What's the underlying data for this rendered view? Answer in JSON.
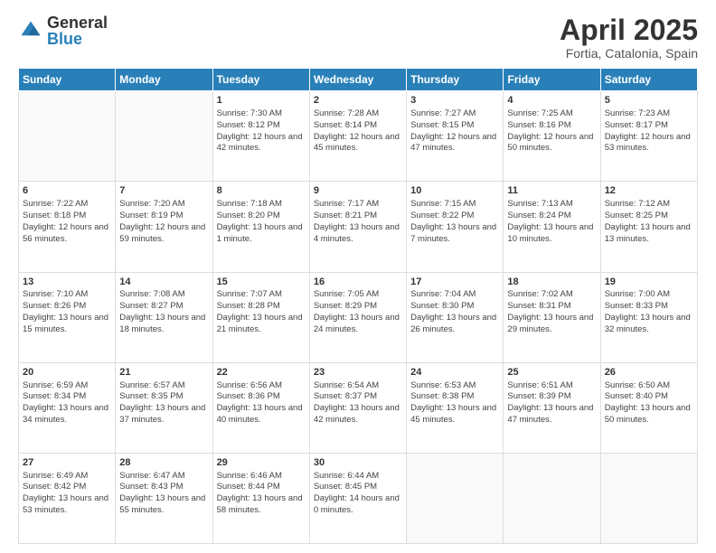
{
  "header": {
    "logo_general": "General",
    "logo_blue": "Blue",
    "title": "April 2025",
    "location": "Fortia, Catalonia, Spain"
  },
  "weekdays": [
    "Sunday",
    "Monday",
    "Tuesday",
    "Wednesday",
    "Thursday",
    "Friday",
    "Saturday"
  ],
  "weeks": [
    [
      {
        "day": "",
        "info": ""
      },
      {
        "day": "",
        "info": ""
      },
      {
        "day": "1",
        "info": "Sunrise: 7:30 AM\nSunset: 8:12 PM\nDaylight: 12 hours and 42 minutes."
      },
      {
        "day": "2",
        "info": "Sunrise: 7:28 AM\nSunset: 8:14 PM\nDaylight: 12 hours and 45 minutes."
      },
      {
        "day": "3",
        "info": "Sunrise: 7:27 AM\nSunset: 8:15 PM\nDaylight: 12 hours and 47 minutes."
      },
      {
        "day": "4",
        "info": "Sunrise: 7:25 AM\nSunset: 8:16 PM\nDaylight: 12 hours and 50 minutes."
      },
      {
        "day": "5",
        "info": "Sunrise: 7:23 AM\nSunset: 8:17 PM\nDaylight: 12 hours and 53 minutes."
      }
    ],
    [
      {
        "day": "6",
        "info": "Sunrise: 7:22 AM\nSunset: 8:18 PM\nDaylight: 12 hours and 56 minutes."
      },
      {
        "day": "7",
        "info": "Sunrise: 7:20 AM\nSunset: 8:19 PM\nDaylight: 12 hours and 59 minutes."
      },
      {
        "day": "8",
        "info": "Sunrise: 7:18 AM\nSunset: 8:20 PM\nDaylight: 13 hours and 1 minute."
      },
      {
        "day": "9",
        "info": "Sunrise: 7:17 AM\nSunset: 8:21 PM\nDaylight: 13 hours and 4 minutes."
      },
      {
        "day": "10",
        "info": "Sunrise: 7:15 AM\nSunset: 8:22 PM\nDaylight: 13 hours and 7 minutes."
      },
      {
        "day": "11",
        "info": "Sunrise: 7:13 AM\nSunset: 8:24 PM\nDaylight: 13 hours and 10 minutes."
      },
      {
        "day": "12",
        "info": "Sunrise: 7:12 AM\nSunset: 8:25 PM\nDaylight: 13 hours and 13 minutes."
      }
    ],
    [
      {
        "day": "13",
        "info": "Sunrise: 7:10 AM\nSunset: 8:26 PM\nDaylight: 13 hours and 15 minutes."
      },
      {
        "day": "14",
        "info": "Sunrise: 7:08 AM\nSunset: 8:27 PM\nDaylight: 13 hours and 18 minutes."
      },
      {
        "day": "15",
        "info": "Sunrise: 7:07 AM\nSunset: 8:28 PM\nDaylight: 13 hours and 21 minutes."
      },
      {
        "day": "16",
        "info": "Sunrise: 7:05 AM\nSunset: 8:29 PM\nDaylight: 13 hours and 24 minutes."
      },
      {
        "day": "17",
        "info": "Sunrise: 7:04 AM\nSunset: 8:30 PM\nDaylight: 13 hours and 26 minutes."
      },
      {
        "day": "18",
        "info": "Sunrise: 7:02 AM\nSunset: 8:31 PM\nDaylight: 13 hours and 29 minutes."
      },
      {
        "day": "19",
        "info": "Sunrise: 7:00 AM\nSunset: 8:33 PM\nDaylight: 13 hours and 32 minutes."
      }
    ],
    [
      {
        "day": "20",
        "info": "Sunrise: 6:59 AM\nSunset: 8:34 PM\nDaylight: 13 hours and 34 minutes."
      },
      {
        "day": "21",
        "info": "Sunrise: 6:57 AM\nSunset: 8:35 PM\nDaylight: 13 hours and 37 minutes."
      },
      {
        "day": "22",
        "info": "Sunrise: 6:56 AM\nSunset: 8:36 PM\nDaylight: 13 hours and 40 minutes."
      },
      {
        "day": "23",
        "info": "Sunrise: 6:54 AM\nSunset: 8:37 PM\nDaylight: 13 hours and 42 minutes."
      },
      {
        "day": "24",
        "info": "Sunrise: 6:53 AM\nSunset: 8:38 PM\nDaylight: 13 hours and 45 minutes."
      },
      {
        "day": "25",
        "info": "Sunrise: 6:51 AM\nSunset: 8:39 PM\nDaylight: 13 hours and 47 minutes."
      },
      {
        "day": "26",
        "info": "Sunrise: 6:50 AM\nSunset: 8:40 PM\nDaylight: 13 hours and 50 minutes."
      }
    ],
    [
      {
        "day": "27",
        "info": "Sunrise: 6:49 AM\nSunset: 8:42 PM\nDaylight: 13 hours and 53 minutes."
      },
      {
        "day": "28",
        "info": "Sunrise: 6:47 AM\nSunset: 8:43 PM\nDaylight: 13 hours and 55 minutes."
      },
      {
        "day": "29",
        "info": "Sunrise: 6:46 AM\nSunset: 8:44 PM\nDaylight: 13 hours and 58 minutes."
      },
      {
        "day": "30",
        "info": "Sunrise: 6:44 AM\nSunset: 8:45 PM\nDaylight: 14 hours and 0 minutes."
      },
      {
        "day": "",
        "info": ""
      },
      {
        "day": "",
        "info": ""
      },
      {
        "day": "",
        "info": ""
      }
    ]
  ]
}
